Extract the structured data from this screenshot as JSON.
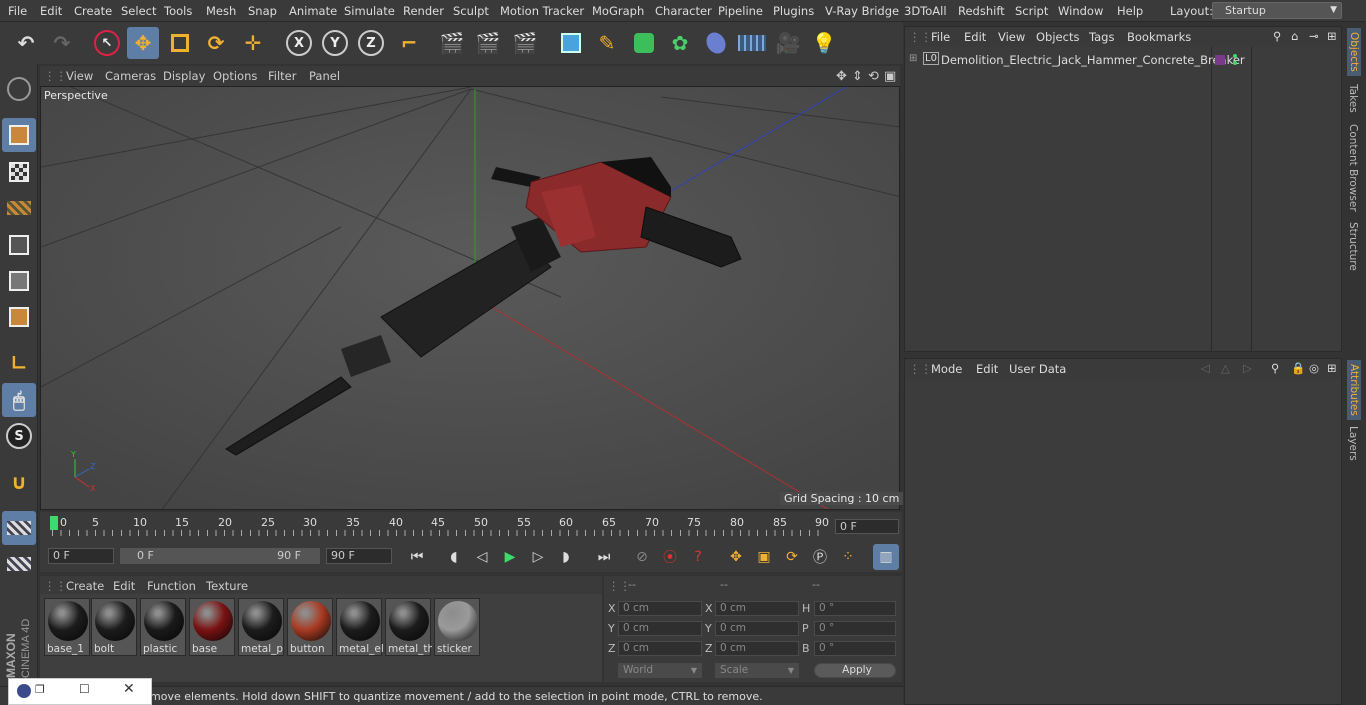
{
  "menubar": {
    "items": [
      "File",
      "Edit",
      "Create",
      "Select",
      "Tools",
      "Mesh",
      "Snap",
      "Animate",
      "Simulate",
      "Render",
      "Sculpt",
      "Motion Tracker",
      "MoGraph",
      "Character",
      "Pipeline",
      "Plugins",
      "V-Ray Bridge",
      "3DToAll",
      "Redshift",
      "Script",
      "Window",
      "Help"
    ],
    "layout_label": "Layout:",
    "layout_value": "Startup"
  },
  "toolbar": {
    "axis_x": "X",
    "axis_y": "Y",
    "axis_z": "Z"
  },
  "viewport": {
    "menu": [
      "View",
      "Cameras",
      "Display",
      "Options",
      "Filter",
      "Panel"
    ],
    "camera_label": "Perspective",
    "grid_spacing": "Grid Spacing : 10 cm"
  },
  "timeline": {
    "ticks": [
      "0",
      "5",
      "10",
      "15",
      "20",
      "25",
      "30",
      "35",
      "40",
      "45",
      "50",
      "55",
      "60",
      "65",
      "70",
      "75",
      "80",
      "85",
      "90"
    ],
    "current_frame": "0 F",
    "start_field": "0 F",
    "range_start": "0 F",
    "range_end": "90 F",
    "end_field": "90 F"
  },
  "materials": {
    "menu": [
      "Create",
      "Edit",
      "Function",
      "Texture"
    ],
    "items": [
      {
        "name": "base_1",
        "color": "#1c1c1c"
      },
      {
        "name": "bolt",
        "color": "#1c1c1c"
      },
      {
        "name": "plastic",
        "color": "#1a1a1a"
      },
      {
        "name": "base",
        "color": "#7a1212"
      },
      {
        "name": "metal_p",
        "color": "#1c1c1c"
      },
      {
        "name": "button",
        "color": "#a83a22"
      },
      {
        "name": "metal_el",
        "color": "#1c1c1c"
      },
      {
        "name": "metal_th",
        "color": "#1c1c1c"
      },
      {
        "name": "sticker",
        "color": "#9a9a9a"
      }
    ]
  },
  "coordinates": {
    "header": [
      "--",
      "--",
      "--"
    ],
    "rows": [
      {
        "a": "X",
        "av": "0 cm",
        "b": "X",
        "bv": "0 cm",
        "c": "H",
        "cv": "0 °"
      },
      {
        "a": "Y",
        "av": "0 cm",
        "b": "Y",
        "bv": "0 cm",
        "c": "P",
        "cv": "0 °"
      },
      {
        "a": "Z",
        "av": "0 cm",
        "b": "Z",
        "bv": "0 cm",
        "c": "B",
        "cv": "0 °"
      }
    ],
    "world": "World",
    "scale": "Scale",
    "apply": "Apply"
  },
  "status": "move elements. Hold down SHIFT to quantize movement / add to the selection in point mode, CTRL to remove.",
  "objects_panel": {
    "menu": [
      "File",
      "Edit",
      "View",
      "Objects",
      "Tags",
      "Bookmarks"
    ],
    "object_name": "Demolition_Electric_Jack_Hammer_Concrete_Breaker",
    "layer_badge": "L0"
  },
  "attributes_panel": {
    "menu": [
      "Mode",
      "Edit",
      "User Data"
    ]
  },
  "right_tabs": [
    "Objects",
    "Takes",
    "Content Browser",
    "Structure"
  ],
  "right_tabs_lower": [
    "Attributes",
    "Layers"
  ],
  "logo": {
    "line1": "MAXON",
    "line2": "CINEMA 4D"
  }
}
